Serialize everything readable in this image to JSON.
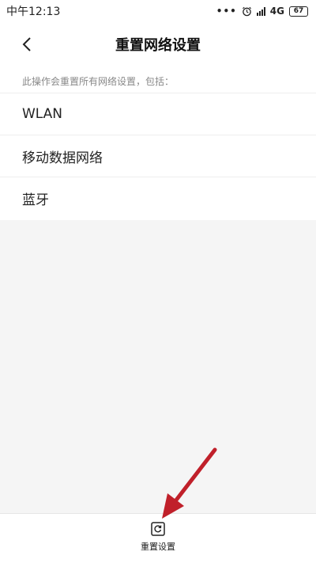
{
  "status_bar": {
    "time": "中午12:13",
    "network": "4G",
    "battery": "67"
  },
  "header": {
    "title": "重置网络设置"
  },
  "content": {
    "description": "此操作会重置所有网络设置，包括：",
    "items": [
      {
        "label": "WLAN"
      },
      {
        "label": "移动数据网络"
      },
      {
        "label": "蓝牙"
      }
    ]
  },
  "bottom_bar": {
    "reset_label": "重置设置"
  },
  "colors": {
    "annotation_arrow": "#c0202a",
    "background": "#f5f5f5"
  }
}
